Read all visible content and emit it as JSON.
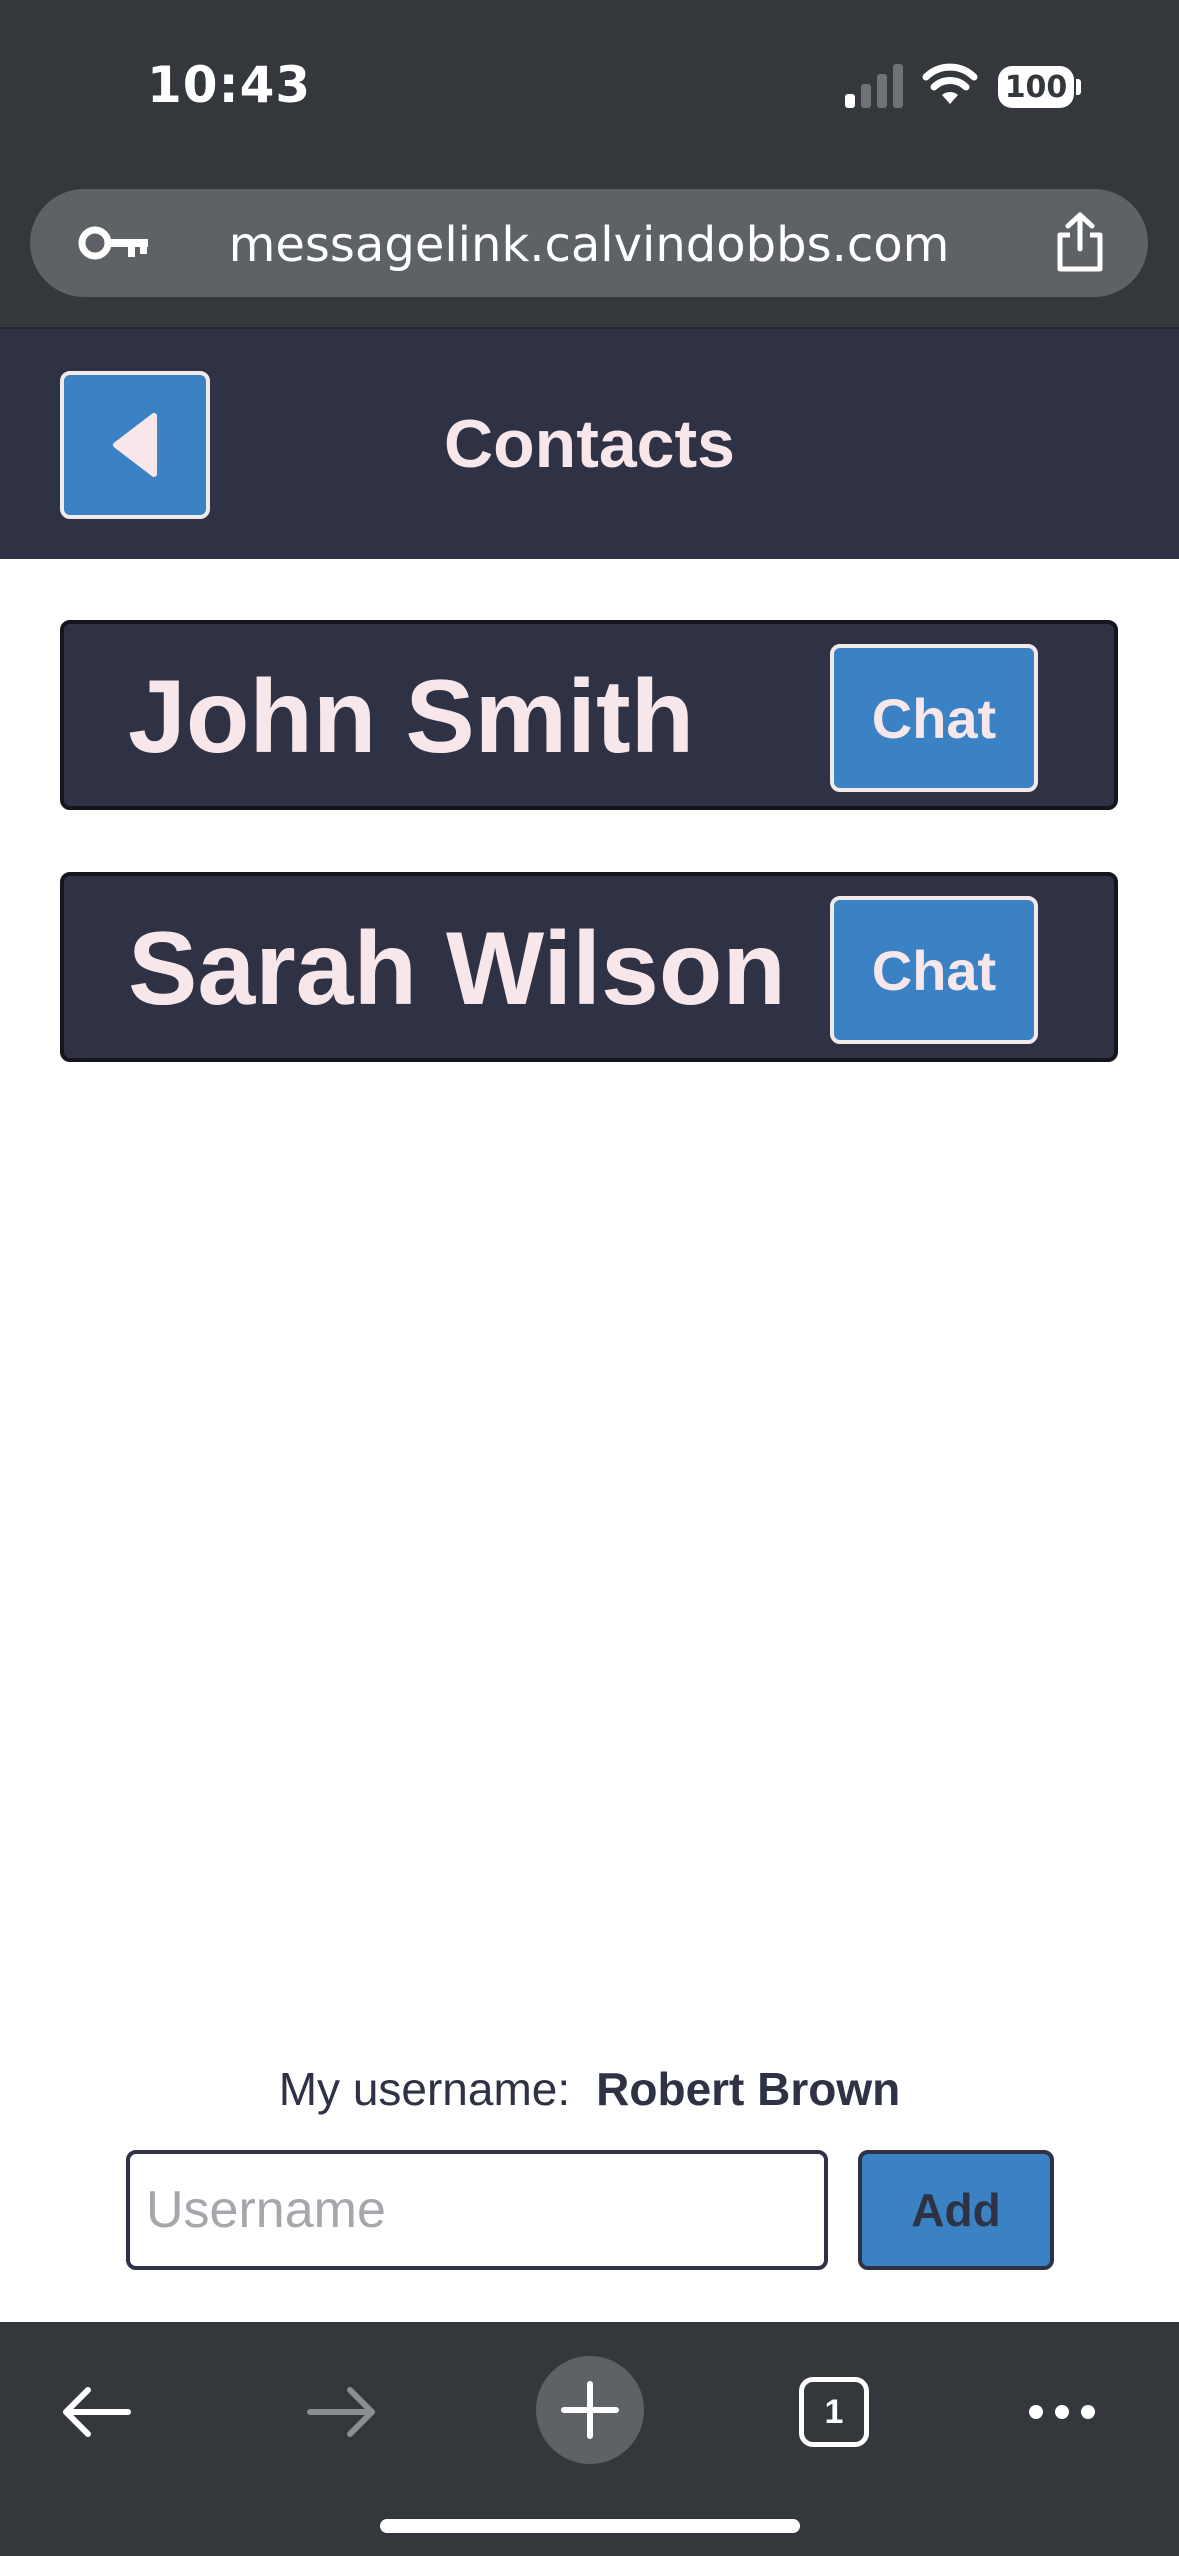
{
  "status_bar": {
    "time": "10:43",
    "battery": "100",
    "icons": [
      "signal-icon",
      "wifi-icon",
      "battery-icon"
    ]
  },
  "browser": {
    "url": "messagelink.calvindobbs.com",
    "icons": [
      "key-icon",
      "share-icon",
      "back-arrow-icon",
      "forward-arrow-icon",
      "plus-icon",
      "tabs-icon",
      "more-icon"
    ],
    "tab_count": "1"
  },
  "header": {
    "title": "Contacts",
    "back_icon": "triangle-left-icon"
  },
  "contacts": [
    {
      "name": "John Smith",
      "action": "Chat"
    },
    {
      "name": "Sarah Wilson",
      "action": "Chat"
    }
  ],
  "footer": {
    "username_label": "My username:",
    "username_value": "Robert Brown",
    "input_placeholder": "Username",
    "input_value": "",
    "add_label": "Add"
  },
  "colors": {
    "chrome": "#34373b",
    "navy": "#2f3144",
    "accent_blue": "#3b82c4",
    "text_light": "#f7e7ea"
  }
}
